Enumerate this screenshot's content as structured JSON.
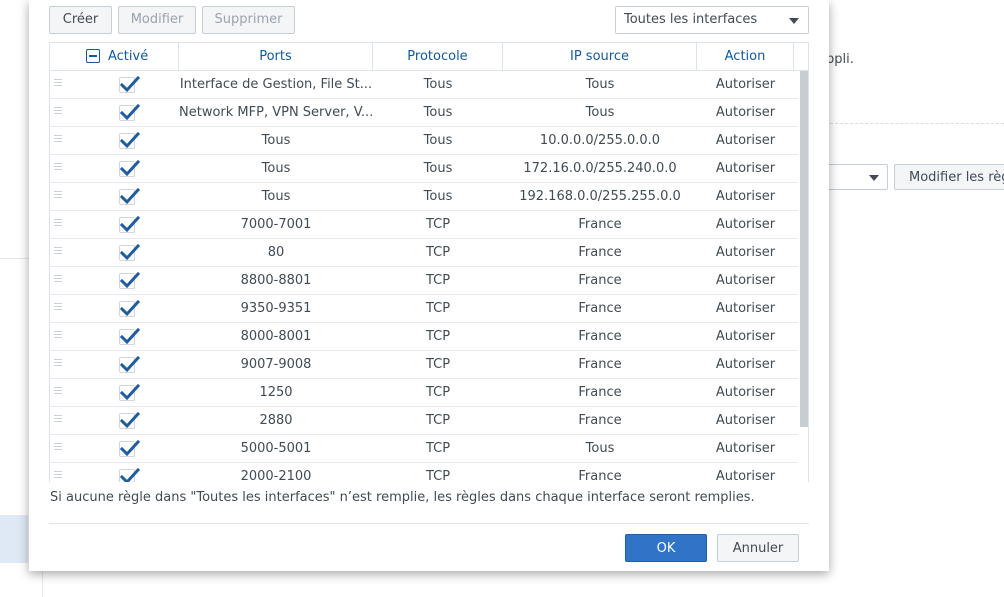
{
  "background": {
    "appli_text": "ppli.",
    "modify_rules_button": "Modifier les règl"
  },
  "toolbar": {
    "create_label": "Créer",
    "modify_label": "Modifier",
    "delete_label": "Supprimer",
    "interface_select": "Toutes les interfaces"
  },
  "table": {
    "columns": {
      "enabled": "Activé",
      "ports": "Ports",
      "protocol": "Protocole",
      "source_ip": "IP source",
      "action": "Action"
    },
    "rows": [
      {
        "enabled": true,
        "ports": "Interface de Gestion, File St...",
        "protocol": "Tous",
        "source_ip": "Tous",
        "action": "Autoriser"
      },
      {
        "enabled": true,
        "ports": "Network MFP, VPN Server, V...",
        "protocol": "Tous",
        "source_ip": "Tous",
        "action": "Autoriser"
      },
      {
        "enabled": true,
        "ports": "Tous",
        "protocol": "Tous",
        "source_ip": "10.0.0.0/255.0.0.0",
        "action": "Autoriser"
      },
      {
        "enabled": true,
        "ports": "Tous",
        "protocol": "Tous",
        "source_ip": "172.16.0.0/255.240.0.0",
        "action": "Autoriser"
      },
      {
        "enabled": true,
        "ports": "Tous",
        "protocol": "Tous",
        "source_ip": "192.168.0.0/255.255.0.0",
        "action": "Autoriser"
      },
      {
        "enabled": true,
        "ports": "7000-7001",
        "protocol": "TCP",
        "source_ip": "France",
        "action": "Autoriser"
      },
      {
        "enabled": true,
        "ports": "80",
        "protocol": "TCP",
        "source_ip": "France",
        "action": "Autoriser"
      },
      {
        "enabled": true,
        "ports": "8800-8801",
        "protocol": "TCP",
        "source_ip": "France",
        "action": "Autoriser"
      },
      {
        "enabled": true,
        "ports": "9350-9351",
        "protocol": "TCP",
        "source_ip": "France",
        "action": "Autoriser"
      },
      {
        "enabled": true,
        "ports": "8000-8001",
        "protocol": "TCP",
        "source_ip": "France",
        "action": "Autoriser"
      },
      {
        "enabled": true,
        "ports": "9007-9008",
        "protocol": "TCP",
        "source_ip": "France",
        "action": "Autoriser"
      },
      {
        "enabled": true,
        "ports": "1250",
        "protocol": "TCP",
        "source_ip": "France",
        "action": "Autoriser"
      },
      {
        "enabled": true,
        "ports": "2880",
        "protocol": "TCP",
        "source_ip": "France",
        "action": "Autoriser"
      },
      {
        "enabled": true,
        "ports": "5000-5001",
        "protocol": "TCP",
        "source_ip": "Tous",
        "action": "Autoriser"
      },
      {
        "enabled": true,
        "ports": "2000-2100",
        "protocol": "TCP",
        "source_ip": "France",
        "action": "Autoriser"
      }
    ]
  },
  "info_text": "Si aucune règle dans \"Toutes les interfaces\" n’est remplie, les règles dans chaque interface seront remplies.",
  "footer": {
    "ok_label": "OK",
    "cancel_label": "Annuler"
  },
  "colors": {
    "accent": "#0e5aa7",
    "primary_button": "#2f74c6",
    "checkbox": "#1f5d9e"
  }
}
